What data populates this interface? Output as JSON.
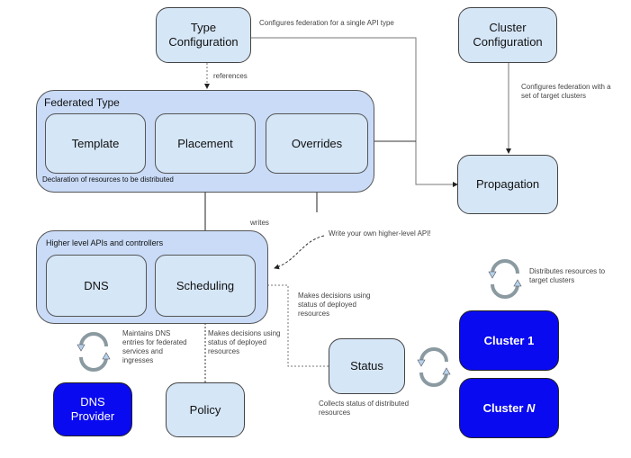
{
  "nodes": {
    "type_configuration": "Type\nConfiguration",
    "cluster_configuration": "Cluster\nConfiguration",
    "propagation": "Propagation",
    "status": "Status",
    "policy": "Policy",
    "dns_provider": "DNS\nProvider",
    "cluster_1": "Cluster 1",
    "cluster_n_prefix": "Cluster ",
    "cluster_n_suffix": "N"
  },
  "groups": {
    "federated_type": {
      "title": "Federated Type",
      "caption": "Declaration of resources to be distributed",
      "items": [
        "Template",
        "Placement",
        "Overrides"
      ]
    },
    "higher_level": {
      "title": "Higher level APIs and controllers",
      "items": [
        "DNS",
        "Scheduling"
      ]
    }
  },
  "annotations": {
    "type_config_note": "Configures federation for a single API type",
    "references": "references",
    "cluster_config_note": "Configures federation with a set of target clusters",
    "writes": "writes",
    "write_own_api": "Write your own higher-level API!",
    "scheduling_decisions": "Makes decisions using status of deployed resources",
    "policy_decisions": "Makes decisions using status of deployed resources",
    "dns_maintains": "Maintains DNS entries for federated services and ingresses",
    "distributes": "Distributes resources to target clusters",
    "collects_status": "Collects status of distributed resources"
  },
  "colors": {
    "light_box": "#d5e6f7",
    "group_fill": "#c9dbf7",
    "dark_box": "#0a0af0"
  }
}
